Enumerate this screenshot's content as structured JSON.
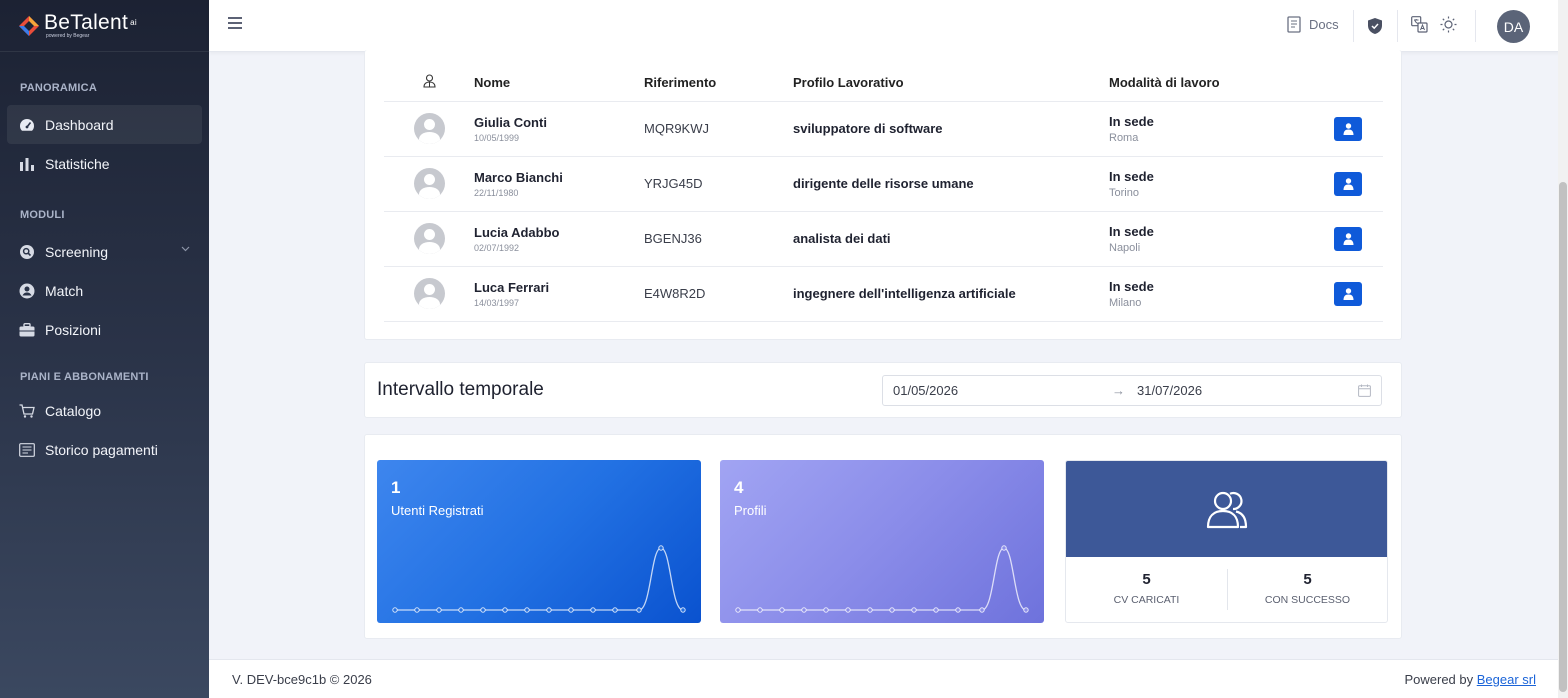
{
  "brand": {
    "name": "BeTalent",
    "suffix": "ai",
    "tagline": "powered by Begear"
  },
  "sidebar": {
    "sections": [
      {
        "title": "PANORAMICA",
        "items": [
          {
            "label": "Dashboard",
            "icon": "gauge-icon",
            "active": true
          },
          {
            "label": "Statistiche",
            "icon": "bar-chart-icon"
          }
        ]
      },
      {
        "title": "MODULI",
        "items": [
          {
            "label": "Screening",
            "icon": "search-icon"
          },
          {
            "label": "Match",
            "icon": "user-circle-icon"
          },
          {
            "label": "Posizioni",
            "icon": "briefcase-icon"
          }
        ]
      },
      {
        "title": "PIANI E ABBONAMENTI",
        "items": [
          {
            "label": "Catalogo",
            "icon": "cart-icon"
          },
          {
            "label": "Storico pagamenti",
            "icon": "receipt-icon"
          }
        ]
      }
    ]
  },
  "header": {
    "docs_label": "Docs",
    "avatar_initials": "DA"
  },
  "table": {
    "headers": {
      "name": "Nome",
      "reference": "Riferimento",
      "profile": "Profilo Lavorativo",
      "mode": "Modalità di lavoro"
    },
    "rows": [
      {
        "name": "Giulia Conti",
        "dob": "10/05/1999",
        "ref": "MQR9KWJ",
        "profile": "sviluppatore di software",
        "mode": "In sede",
        "city": "Roma"
      },
      {
        "name": "Marco Bianchi",
        "dob": "22/11/1980",
        "ref": "YRJG45D",
        "profile": "dirigente delle risorse umane",
        "mode": "In sede",
        "city": "Torino"
      },
      {
        "name": "Lucia Adabbo",
        "dob": "02/07/1992",
        "ref": "BGENJ36",
        "profile": "analista dei dati",
        "mode": "In sede",
        "city": "Napoli"
      },
      {
        "name": "Luca Ferrari",
        "dob": "14/03/1997",
        "ref": "E4W8R2D",
        "profile": "ingegnere dell'intelligenza artificiale",
        "mode": "In sede",
        "city": "Milano"
      }
    ]
  },
  "interval": {
    "title": "Intervallo temporale",
    "start": "01/05/2026",
    "end": "31/07/2026"
  },
  "stats": {
    "users": {
      "value": "1",
      "label": "Utenti Registrati",
      "color": "#2271e3"
    },
    "profiles": {
      "value": "4",
      "label": "Profili",
      "color": "#8a8ce9"
    },
    "cv": {
      "uploaded_value": "5",
      "uploaded_label": "CV CARICATI",
      "success_value": "5",
      "success_label": "CON SUCCESSO",
      "color": "#3d5898"
    }
  },
  "footer": {
    "version": "V. DEV-bce9c1b © 2026",
    "powered_prefix": "Powered by",
    "powered_link": "Begear srl"
  }
}
